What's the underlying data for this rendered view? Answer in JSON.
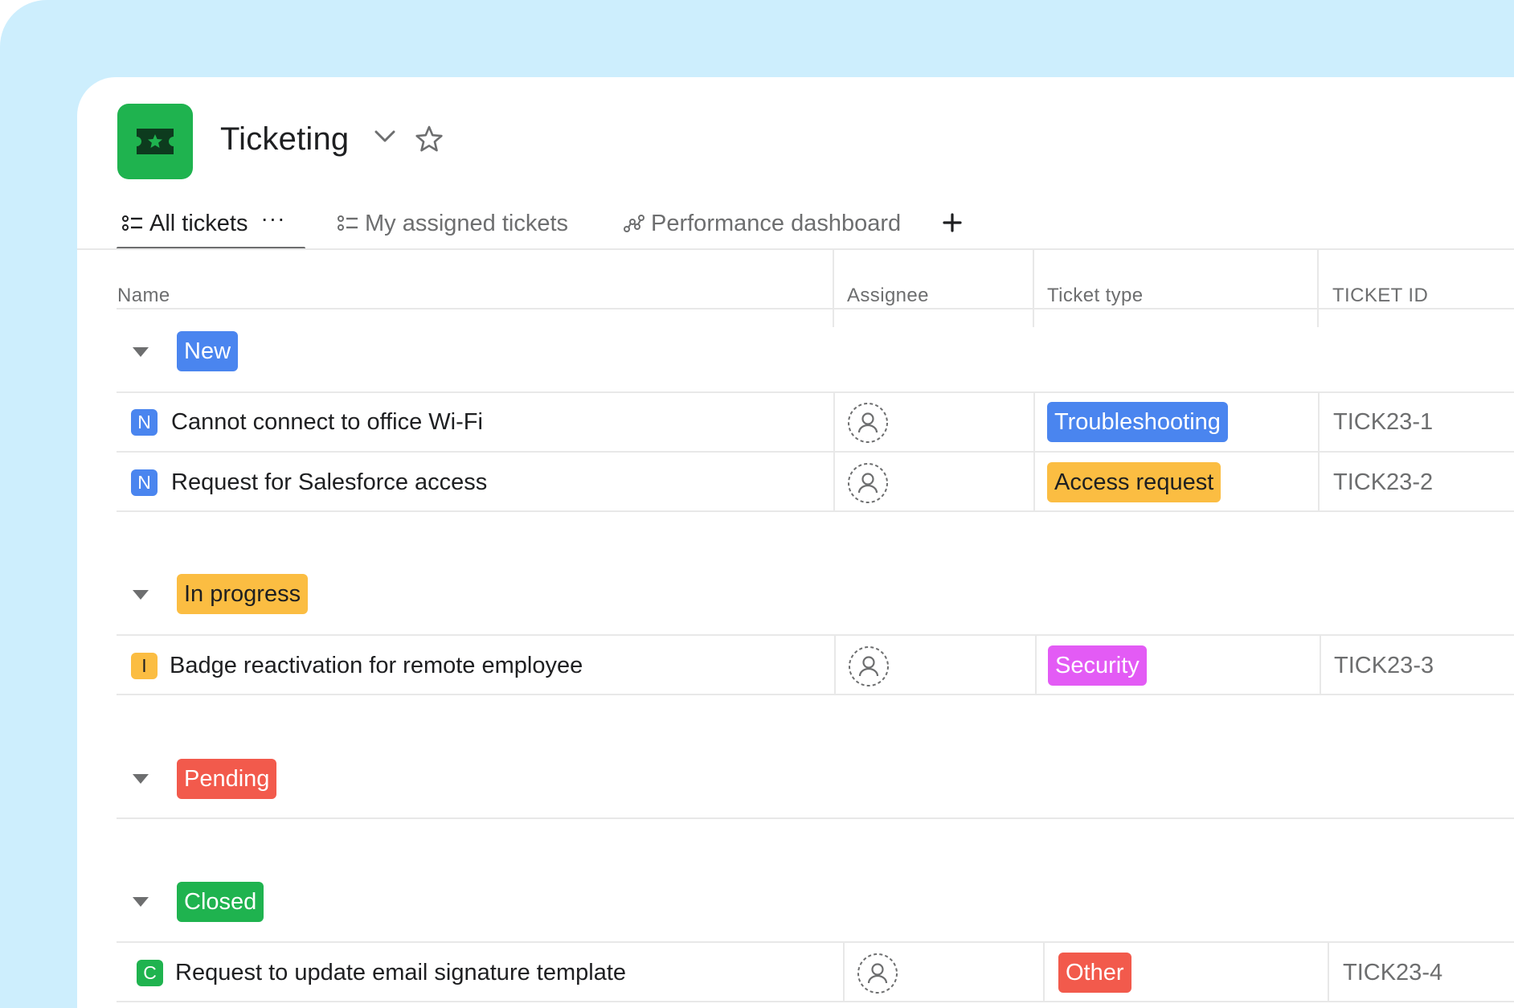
{
  "app": {
    "title": "Ticketing",
    "icon": "ticket-icon",
    "icon_color": "#1fb34f"
  },
  "tabs": [
    {
      "label": "All tickets",
      "icon": "list-icon",
      "active": true
    },
    {
      "label": "My assigned tickets",
      "icon": "list-icon",
      "active": false
    },
    {
      "label": "Performance dashboard",
      "icon": "dashboard-icon",
      "active": false
    }
  ],
  "columns": {
    "name": "Name",
    "assignee": "Assignee",
    "ticket_type": "Ticket type",
    "ticket_id": "TICKET ID"
  },
  "groups": [
    {
      "label": "New",
      "color": "#4a85ef",
      "rows": [
        {
          "badge": "N",
          "badge_color": "#4a85ef",
          "name": "Cannot connect to office Wi-Fi",
          "type": "Troubleshooting",
          "type_color": "#4a85ef",
          "type_text_color": "#ffffff",
          "id": "TICK23-1"
        },
        {
          "badge": "N",
          "badge_color": "#4a85ef",
          "name": "Request for Salesforce access",
          "type": "Access request",
          "type_color": "#fbbd42",
          "type_text_color": "#1e1f21",
          "id": "TICK23-2"
        }
      ]
    },
    {
      "label": "In progress",
      "color": "#fbbd42",
      "text_color": "#1e1f21",
      "rows": [
        {
          "badge": "I",
          "badge_color": "#fbbd42",
          "name": "Badge reactivation for remote employee",
          "type": "Security",
          "type_color": "#e35bf5",
          "type_text_color": "#ffffff",
          "id": "TICK23-3"
        }
      ]
    },
    {
      "label": "Pending",
      "color": "#f25a4c",
      "rows": []
    },
    {
      "label": "Closed",
      "color": "#1fb34f",
      "rows": [
        {
          "badge": "C",
          "badge_color": "#1fb34f",
          "name": "Request to update email signature template",
          "type": "Other",
          "type_color": "#f25a4c",
          "type_text_color": "#ffffff",
          "id": "TICK23-4"
        }
      ]
    }
  ]
}
